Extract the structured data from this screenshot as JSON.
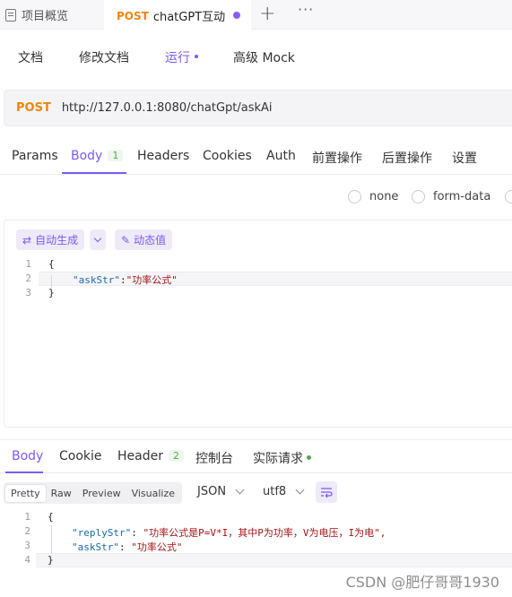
{
  "tabs": {
    "tab1_label": "项目概览",
    "tab2_method": "POST",
    "tab2_name": "chatGPT互动",
    "plus": "+",
    "more": "···"
  },
  "subnav": {
    "doc": "文档",
    "edit_doc": "修改文档",
    "run": "运行",
    "mock": "高级 Mock"
  },
  "request": {
    "method": "POST",
    "url": "http://127.0.0.1:8080/chatGpt/askAi"
  },
  "req_tabs": {
    "params": "Params",
    "body": "Body",
    "body_count": "1",
    "headers": "Headers",
    "cookies": "Cookies",
    "auth": "Auth",
    "pre": "前置操作",
    "post": "后置操作",
    "settings": "设置"
  },
  "body_types": {
    "none": "none",
    "form_data": "form-data"
  },
  "editor": {
    "auto_gen": "自动生成",
    "dynamic": "动态值",
    "lines": [
      {
        "n": "1",
        "key": "",
        "sep": "",
        "val": "{"
      },
      {
        "n": "2",
        "key": "\"askStr\"",
        "sep": ":",
        "val": "\"功率公式\""
      },
      {
        "n": "3",
        "key": "",
        "sep": "",
        "val": "}"
      }
    ]
  },
  "resp_tabs": {
    "body": "Body",
    "cookie": "Cookie",
    "header": "Header",
    "header_count": "2",
    "console": "控制台",
    "actual": "实际请求"
  },
  "resp_format": {
    "pretty": "Pretty",
    "raw": "Raw",
    "preview": "Preview",
    "visualize": "Visualize",
    "lang": "JSON",
    "encoding": "utf8"
  },
  "response": {
    "lines": [
      {
        "n": "1",
        "key": "",
        "sep": "",
        "val": "{"
      },
      {
        "n": "2",
        "key": "\"replyStr\"",
        "sep": ": ",
        "val": "\"功率公式是P=V*I，其中P为功率，V为电压，I为电\","
      },
      {
        "n": "3",
        "key": "\"askStr\"",
        "sep": ": ",
        "val": "\"功率公式\""
      },
      {
        "n": "4",
        "key": "",
        "sep": "",
        "val": "}"
      }
    ]
  },
  "watermark": "CSDN @肥仔哥哥1930",
  "colors": {
    "accent": "#7a5af5",
    "post": "#f0850a",
    "success": "#4cae4c"
  }
}
